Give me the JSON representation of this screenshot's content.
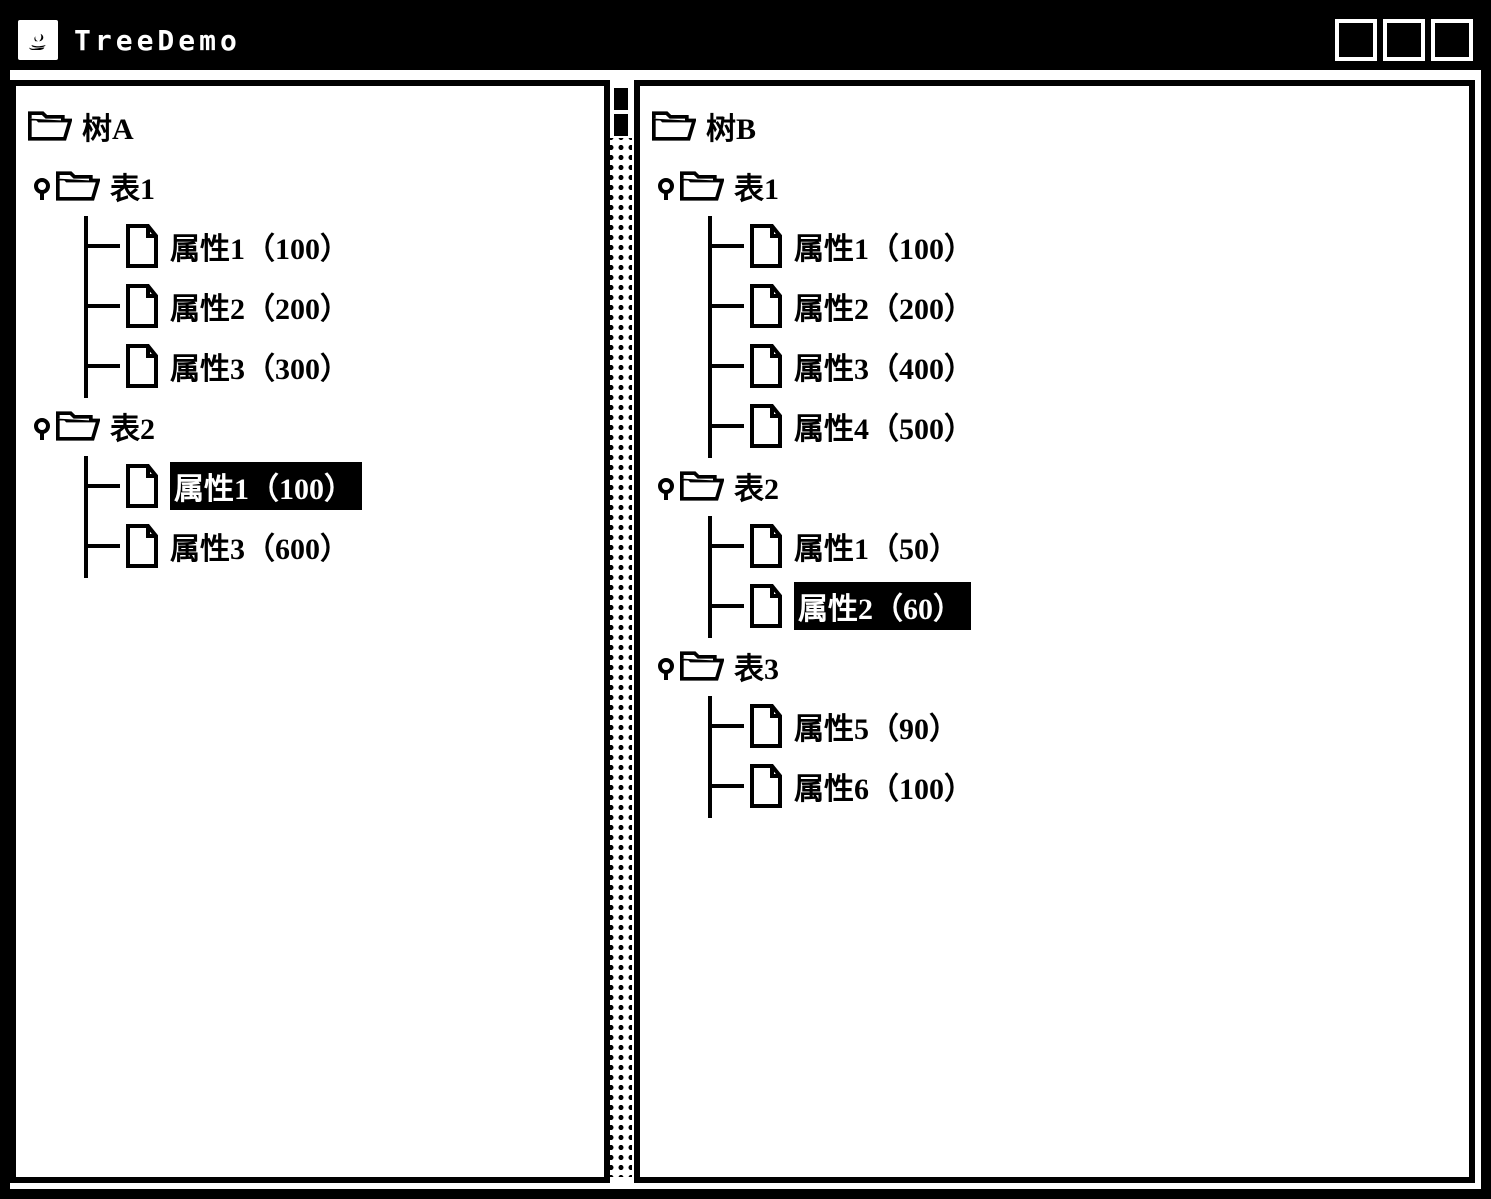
{
  "window": {
    "title": "TreeDemo"
  },
  "left": {
    "root": "树A",
    "tables": [
      {
        "name": "表1",
        "items": [
          {
            "label": "属性1（100）",
            "selected": false
          },
          {
            "label": "属性2（200）",
            "selected": false
          },
          {
            "label": "属性3（300）",
            "selected": false
          }
        ]
      },
      {
        "name": "表2",
        "items": [
          {
            "label": "属性1（100）",
            "selected": true
          },
          {
            "label": "属性3（600）",
            "selected": false
          }
        ]
      }
    ]
  },
  "right": {
    "root": "树B",
    "tables": [
      {
        "name": "表1",
        "items": [
          {
            "label": "属性1（100）",
            "selected": false
          },
          {
            "label": "属性2（200）",
            "selected": false
          },
          {
            "label": "属性3（400）",
            "selected": false
          },
          {
            "label": "属性4（500）",
            "selected": false
          }
        ]
      },
      {
        "name": "表2",
        "items": [
          {
            "label": "属性1（50）",
            "selected": false
          },
          {
            "label": "属性2（60）",
            "selected": true
          }
        ]
      },
      {
        "name": "表3",
        "items": [
          {
            "label": "属性5（90）",
            "selected": false
          },
          {
            "label": "属性6（100）",
            "selected": false
          }
        ]
      }
    ]
  }
}
